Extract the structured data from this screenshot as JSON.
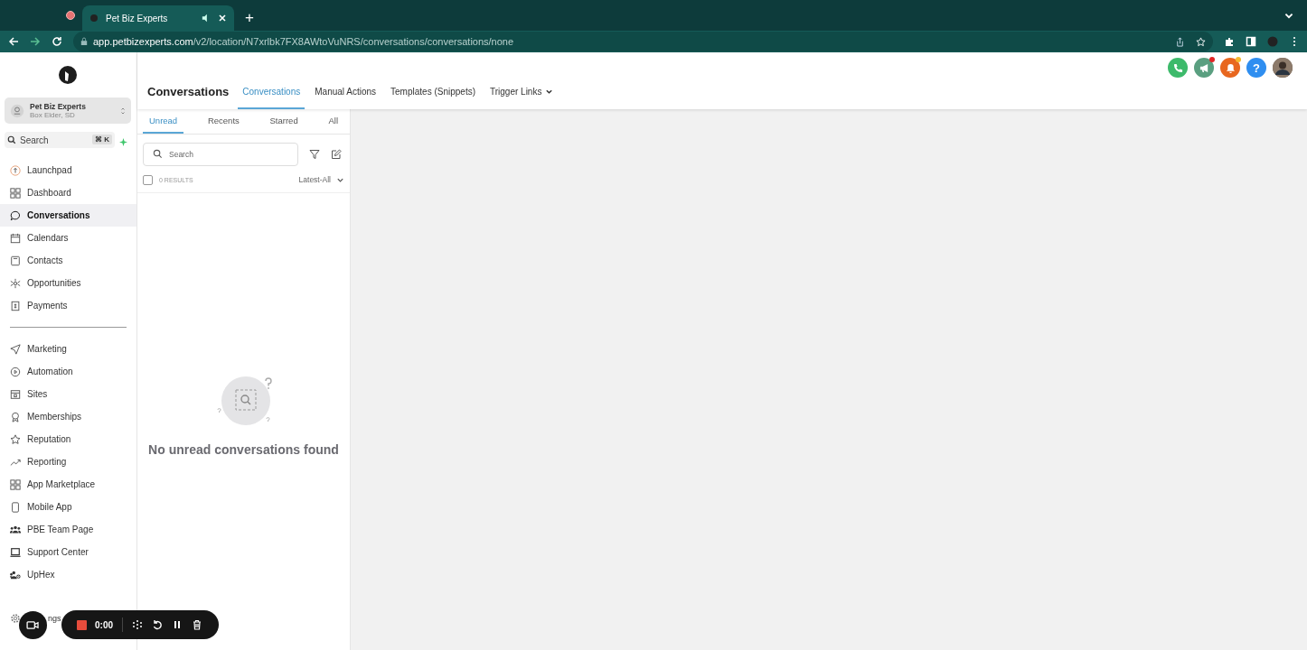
{
  "browser": {
    "tab_title": "Pet Biz Experts",
    "new_tab": "+",
    "url_host": "app.petbizexperts.com",
    "url_path": "/v2/location/N7xrlbk7FX8AWtoVuNRS/conversations/conversations/none"
  },
  "account": {
    "name": "Pet Biz Experts",
    "location": "Box Elder, SD"
  },
  "search": {
    "placeholder": "Search",
    "shortcut": "⌘ K"
  },
  "nav_groups": [
    [
      {
        "label": "Launchpad",
        "selected": false
      },
      {
        "label": "Dashboard",
        "selected": false
      },
      {
        "label": "Conversations",
        "selected": true
      },
      {
        "label": "Calendars",
        "selected": false
      },
      {
        "label": "Contacts",
        "selected": false
      },
      {
        "label": "Opportunities",
        "selected": false
      },
      {
        "label": "Payments",
        "selected": false
      }
    ],
    [
      {
        "label": "Marketing",
        "selected": false
      },
      {
        "label": "Automation",
        "selected": false
      },
      {
        "label": "Sites",
        "selected": false
      },
      {
        "label": "Memberships",
        "selected": false
      },
      {
        "label": "Reputation",
        "selected": false
      },
      {
        "label": "Reporting",
        "selected": false
      },
      {
        "label": "App Marketplace",
        "selected": false
      },
      {
        "label": "Mobile App",
        "selected": false
      },
      {
        "label": "PBE Team Page",
        "selected": false
      },
      {
        "label": "Support Center",
        "selected": false
      },
      {
        "label": "UpHex",
        "selected": false
      }
    ]
  ],
  "settings_visible_text": "ngs",
  "header": {
    "title": "Conversations",
    "tabs": [
      {
        "label": "Conversations",
        "selected": true,
        "kind": "tab"
      },
      {
        "label": "Manual Actions",
        "selected": false,
        "kind": "tab"
      },
      {
        "label": "Templates (Snippets)",
        "selected": false,
        "kind": "tab"
      },
      {
        "label": "Trigger Links",
        "selected": false,
        "kind": "dropdown"
      }
    ]
  },
  "top_actions": [
    {
      "kind": "phone",
      "badge": false
    },
    {
      "kind": "megaphone",
      "badge": true
    },
    {
      "kind": "bell",
      "badge": true
    },
    {
      "kind": "help",
      "label": "?",
      "badge": false
    },
    {
      "kind": "avatar",
      "badge": false
    }
  ],
  "filters": [
    {
      "label": "Unread",
      "selected": true
    },
    {
      "label": "Recents",
      "selected": false
    },
    {
      "label": "Starred",
      "selected": false
    },
    {
      "label": "All",
      "selected": false
    }
  ],
  "list": {
    "search_placeholder": "Search",
    "select_all_checked": false,
    "results": "0 RESULTS",
    "sort": "Latest-All"
  },
  "empty": {
    "message": "No unread conversations found"
  },
  "recorder": {
    "time": "0:00"
  }
}
